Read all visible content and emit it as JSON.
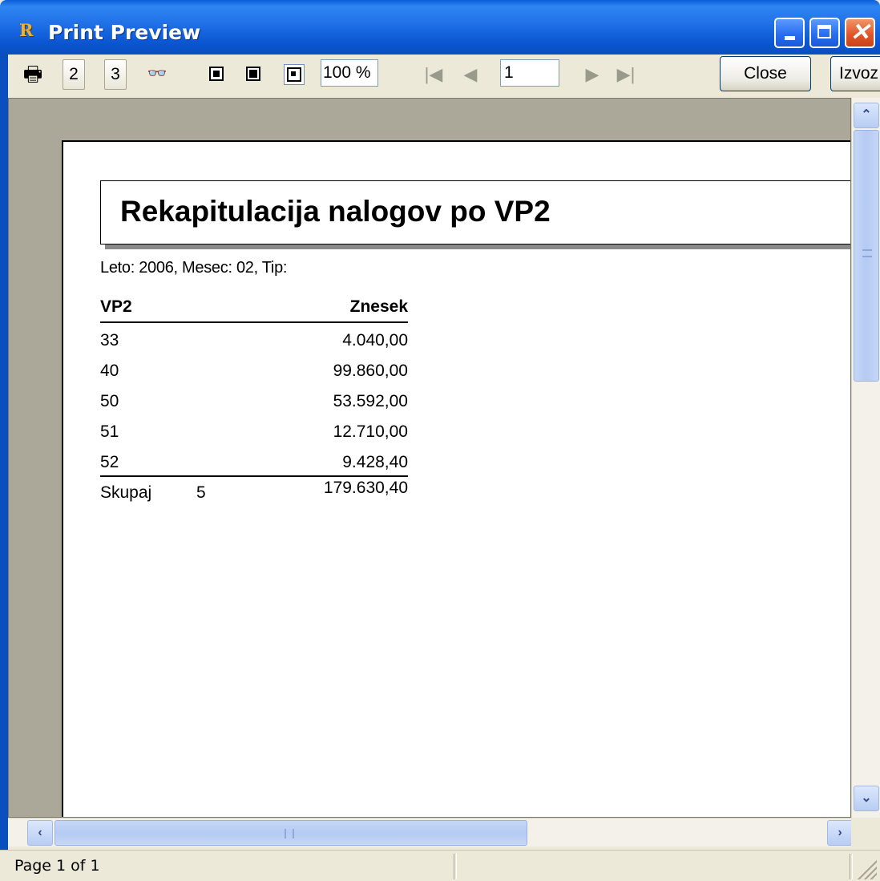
{
  "window": {
    "title": "Print Preview",
    "app_icon_letter": "R",
    "caption_buttons": [
      "minimize",
      "maximize",
      "close"
    ]
  },
  "toolbar": {
    "btn_2": "2",
    "btn_3": "3",
    "zoom": "100 %",
    "page": "1",
    "close_label": "Close",
    "export_label": "Izvoz"
  },
  "report": {
    "title": "Rekapitulacija nalogov po VP2",
    "subtitle": "Leto: 2006,  Mesec: 02,  Tip:",
    "columns": [
      "VP2",
      "Znesek"
    ],
    "rows": [
      {
        "vp2": "33",
        "znesek": "4.040,00"
      },
      {
        "vp2": "40",
        "znesek": "99.860,00"
      },
      {
        "vp2": "50",
        "znesek": "53.592,00"
      },
      {
        "vp2": "51",
        "znesek": "12.710,00"
      },
      {
        "vp2": "52",
        "znesek": "9.428,40"
      }
    ],
    "footer": {
      "label": "Skupaj",
      "count": "5",
      "total": "179.630,40"
    }
  },
  "status": {
    "page_info": "Page 1 of 1"
  }
}
